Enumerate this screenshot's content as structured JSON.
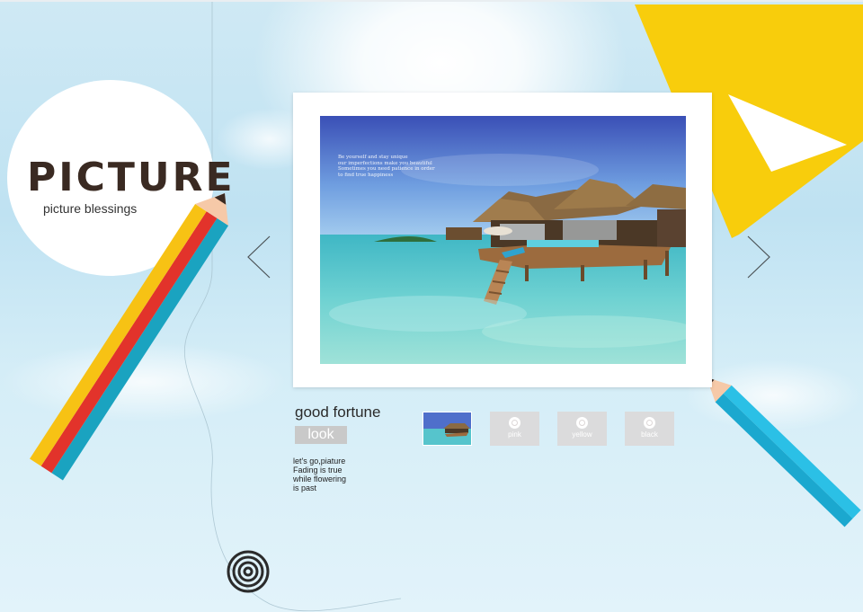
{
  "logo": {
    "word": "PICTURE",
    "subtitle": "picture blessings"
  },
  "photo": {
    "caption_lines": "Be yourself and stay unique\nour imperfections make you beautiful\nSometimes you need patience in order\nto find true happiness"
  },
  "nav": {
    "prev_icon": "chevron-left-icon",
    "next_icon": "chevron-right-icon"
  },
  "detail": {
    "title": "good fortune",
    "look_label": "look",
    "poem": "let's go,piature\nFading is true\nwhile flowering\nis past"
  },
  "thumbnails": [
    {
      "label": "",
      "kind": "photo"
    },
    {
      "label": "pink",
      "kind": "swatch"
    },
    {
      "label": "yellow",
      "kind": "swatch"
    },
    {
      "label": "black",
      "kind": "swatch"
    }
  ],
  "colors": {
    "pencil_teal": "#1aa3c0",
    "pencil_red": "#e2332b",
    "pencil_yellow": "#f7c214",
    "pencil_tip": "#f6c9a8",
    "pencil_blue": "#2bc0e6",
    "ruler_yellow": "#f8cd0c",
    "look_button": "#c9c9c9"
  },
  "decor": {
    "spiral": "spiral-icon"
  }
}
